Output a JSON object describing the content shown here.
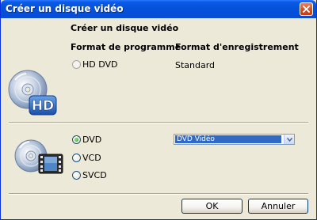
{
  "window": {
    "title": "Créer un disque vidéo"
  },
  "top_section": {
    "heading": "Créer un disque vidéo",
    "program_format_label": "Format de programme",
    "recording_format_label": "Format d'enregistrement",
    "hd_dvd_option": {
      "label": "HD DVD",
      "selected": false,
      "enabled": false
    },
    "recording_format_value": "Standard",
    "icon": "hd-disc-icon"
  },
  "bottom_section": {
    "options": [
      {
        "label": "DVD",
        "selected": true
      },
      {
        "label": "VCD",
        "selected": false
      },
      {
        "label": "SVCD",
        "selected": false
      }
    ],
    "format_select": {
      "selected": "DVD Vidéo"
    },
    "icon": "video-disc-icon"
  },
  "footer": {
    "ok_label": "OK",
    "cancel_label": "Annuler"
  },
  "colors": {
    "titlebar": "#0552d8",
    "dialog_bg": "#ece9d8",
    "selection": "#316ac5"
  }
}
